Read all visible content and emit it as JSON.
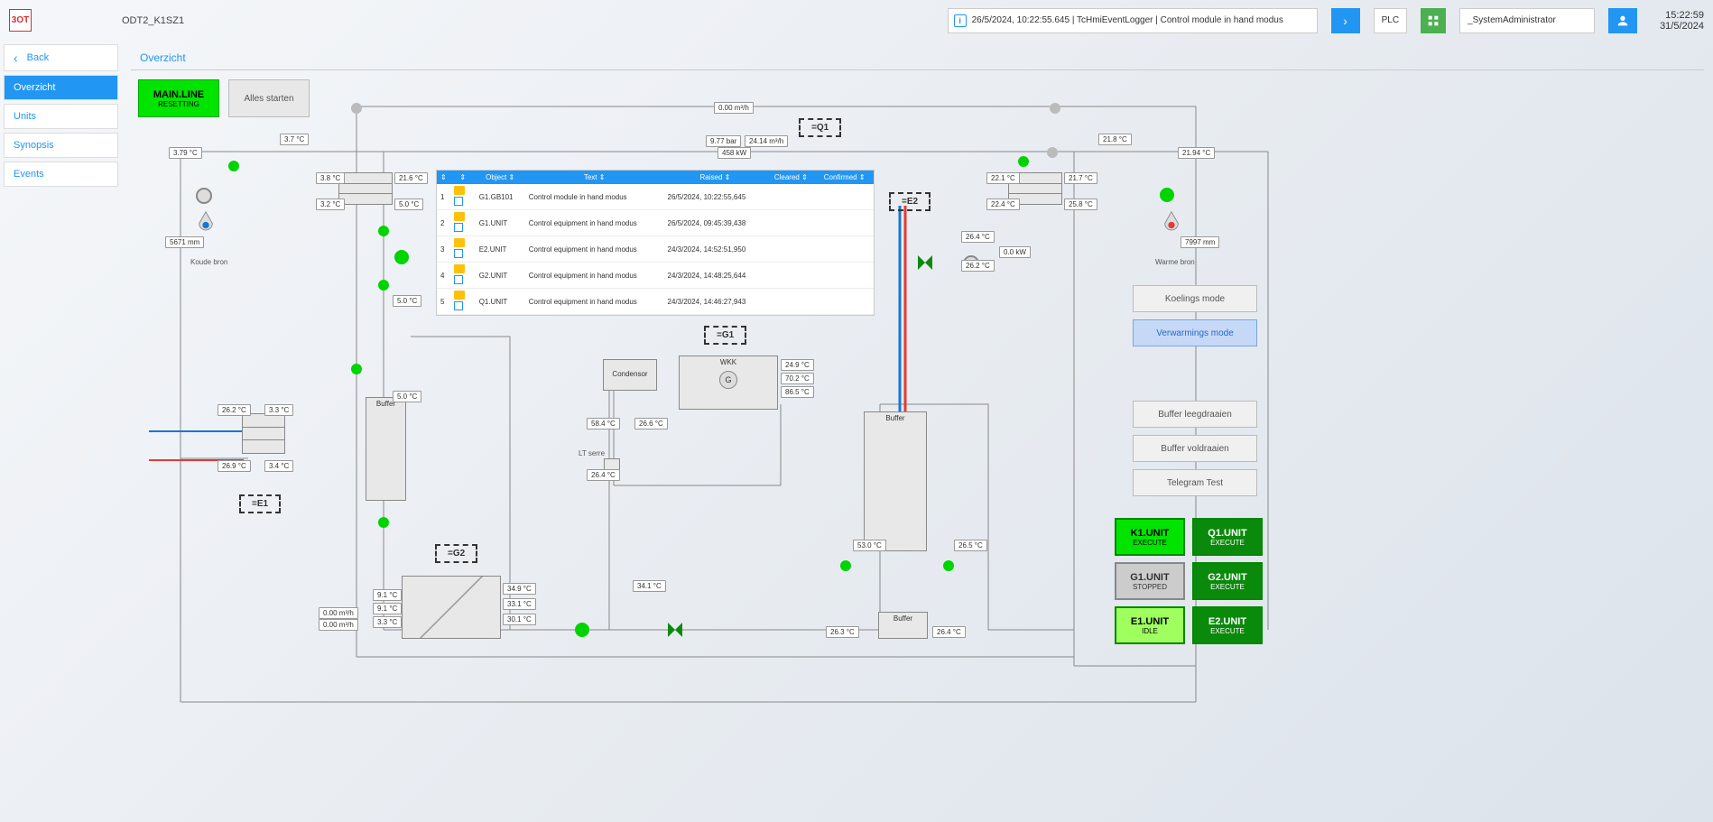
{
  "header": {
    "logo": "3OT",
    "project": "ODT2_K1SZ1",
    "event_text": "26/5/2024, 10:22:55.645 | TcHmiEventLogger | Control module in hand modus",
    "plc": "PLC",
    "user": "_SystemAdministrator",
    "time": "15:22:59",
    "date": "31/5/2024"
  },
  "nav": {
    "back": "Back",
    "items": [
      "Overzicht",
      "Units",
      "Synopsis",
      "Events"
    ]
  },
  "page_title": "Overzicht",
  "mainline": {
    "label": "MAIN.LINE",
    "state": "RESETTING"
  },
  "alles_starten": "Alles starten",
  "units": {
    "q1": "=Q1",
    "e2": "=E2",
    "e1": "=E1",
    "g1": "=G1",
    "g2": "=G2"
  },
  "tags": {
    "t379": "3.79 °C",
    "t37": "3.7 °C",
    "t38": "3.8 °C",
    "t216": "21.6 °C",
    "t32": "3.2 °C",
    "t50a": "5.0 °C",
    "t50b": "5.0 °C",
    "t50c": "5.0 °C",
    "p977": "9.77 bar",
    "f2414": "24.14 m³/h",
    "f000": "0.00 m³/h",
    "kw458": "458 kW",
    "t218": "21.8 °C",
    "t2194": "21.94 °C",
    "t221": "22.1 °C",
    "t217": "21.7 °C",
    "t224": "22.4 °C",
    "t258": "25.8 °C",
    "t264": "26.4 °C",
    "kw00": "0.0 kW",
    "t262a": "26.2 °C",
    "t262b": "26.2 °C",
    "t33a": "3.3 °C",
    "t269": "26.9 °C",
    "t34": "3.4 °C",
    "mm5671": "5671 mm",
    "mm7997": "7997 mm",
    "t249": "24.9 °C",
    "t702": "70.2 °C",
    "t865": "86.5 °C",
    "t584": "58.4 °C",
    "t266": "26.6 °C",
    "t264b": "26.4 °C",
    "t530": "53.0 °C",
    "t265": "26.5 °C",
    "t263": "26.3 °C",
    "t264c": "26.4 °C",
    "t349": "34.9 °C",
    "t331": "33.1 °C",
    "t301": "30.1 °C",
    "t91a": "9.1 °C",
    "t91b": "9.1 °C",
    "t33b": "3.3 °C",
    "f000b": "0.00 m³/h",
    "f000c": "0.00 m³/h",
    "t341": "34.1 °C"
  },
  "labels": {
    "koude_bron": "Koude bron",
    "warme_bron": "Warme bron",
    "buffer": "Buffer",
    "condensor": "Condensor",
    "wkk": "WKK",
    "g": "G",
    "lt_serre": "LT serre"
  },
  "alarm_table": {
    "headers": [
      "",
      "",
      "",
      "Object",
      "Text",
      "Raised",
      "Cleared",
      "Confirmed"
    ],
    "rows": [
      {
        "n": "1",
        "obj": "G1.GB101",
        "txt": "Control module in hand modus",
        "raised": "26/5/2024, 10:22:55,645"
      },
      {
        "n": "2",
        "obj": "G1.UNIT",
        "txt": "Control equipment in hand modus",
        "raised": "26/5/2024, 09:45:39,438"
      },
      {
        "n": "3",
        "obj": "E2.UNIT",
        "txt": "Control equipment in hand modus",
        "raised": "24/3/2024, 14:52:51,950"
      },
      {
        "n": "4",
        "obj": "G2.UNIT",
        "txt": "Control equipment in hand modus",
        "raised": "24/3/2024, 14:48:25,644"
      },
      {
        "n": "5",
        "obj": "Q1.UNIT",
        "txt": "Control equipment in hand modus",
        "raised": "24/3/2024, 14:46:27,943"
      }
    ]
  },
  "right": {
    "koelings": "Koelings mode",
    "verwarmings": "Verwarmings mode",
    "buffer_leeg": "Buffer leegdraaien",
    "buffer_vol": "Buffer voldraaien",
    "telegram": "Telegram Test"
  },
  "unit_buttons": {
    "k1": {
      "label": "K1.UNIT",
      "state": "EXECUTE"
    },
    "q1": {
      "label": "Q1.UNIT",
      "state": "EXECUTE"
    },
    "g1": {
      "label": "G1.UNIT",
      "state": "STOPPED"
    },
    "g2": {
      "label": "G2.UNIT",
      "state": "EXECUTE"
    },
    "e1": {
      "label": "E1.UNIT",
      "state": "IDLE"
    },
    "e2": {
      "label": "E2.UNIT",
      "state": "EXECUTE"
    }
  }
}
